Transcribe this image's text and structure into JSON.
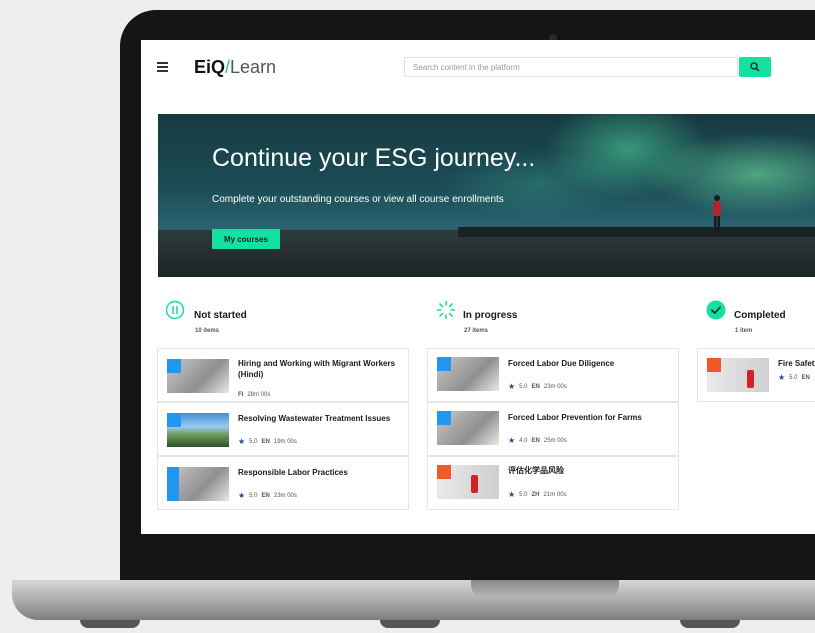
{
  "header": {
    "logo_eiq": "EiQ",
    "logo_slash": "/",
    "logo_learn": "Learn",
    "search_placeholder": "Search content in the platform"
  },
  "hero": {
    "title": "Continue your ESG journey...",
    "subtitle": "Complete your outstanding courses or view all course enrollments",
    "button_label": "My courses"
  },
  "columns": [
    {
      "title": "Not started",
      "count": "10 items",
      "cards": [
        {
          "title": "Hiring and Working with Migrant Workers (Hindi)",
          "lang": "FI",
          "duration": "28m 00s"
        },
        {
          "title": "Resolving Wastewater Treatment Issues",
          "rating": "5.0",
          "lang": "EN",
          "duration": "19m 00s"
        },
        {
          "title": "Responsible Labor Practices",
          "rating": "5.0",
          "lang": "EN",
          "duration": "23m 00s"
        }
      ]
    },
    {
      "title": "In progress",
      "count": "27 items",
      "cards": [
        {
          "title": "Forced Labor Due Diligence",
          "rating": "5.0",
          "lang": "EN",
          "duration": "23m 00s"
        },
        {
          "title": "Forced Labor Prevention for Farms",
          "rating": "4.0",
          "lang": "EN",
          "duration": "25m 00s"
        },
        {
          "title": "评估化学品风险",
          "rating": "5.0",
          "lang": "ZH",
          "duration": "21m 00s"
        }
      ]
    },
    {
      "title": "Completed",
      "count": "1 item",
      "cards": [
        {
          "title": "Fire Safety",
          "rating": "5.0",
          "lang": "EN"
        }
      ]
    }
  ],
  "colors": {
    "accent": "#14e0a2",
    "brand_slash": "#16c9a5",
    "star": "#1d4aa0",
    "tag_blue": "#2196f3",
    "tag_orange": "#f05a28"
  },
  "icons": {
    "menu": "hamburger-icon",
    "search": "search-icon",
    "not_started": "pause-circle-icon",
    "in_progress": "spinner-icon",
    "completed": "check-circle-icon",
    "rating": "star-icon"
  }
}
